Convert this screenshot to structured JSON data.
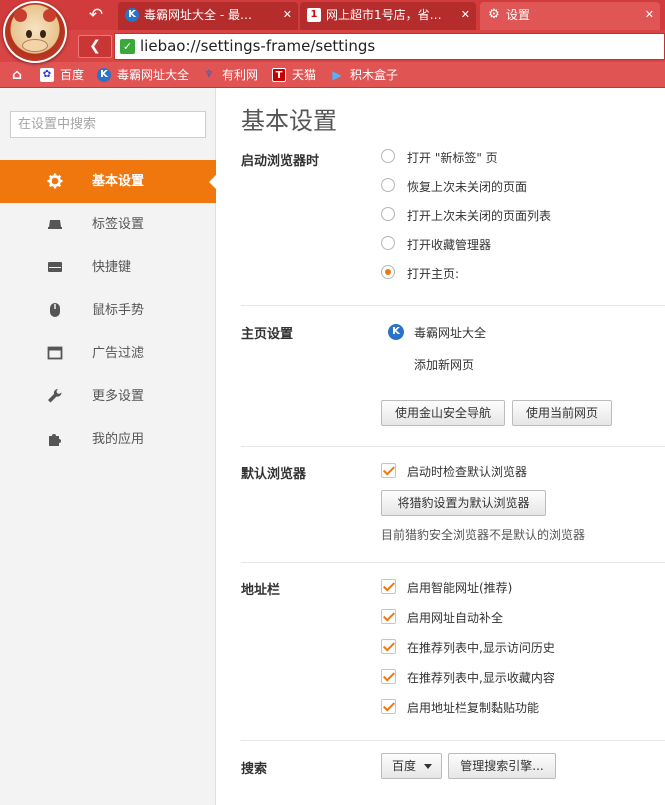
{
  "window": {
    "tabs": [
      {
        "title": "毒霸网址大全 - 最安...",
        "icon": "K",
        "active": false
      },
      {
        "title": "网上超市1号店，省力...",
        "icon": "1",
        "active": false
      },
      {
        "title": "设置",
        "icon": "gear-icon",
        "active": true
      }
    ],
    "url": "liebao://settings-frame/settings"
  },
  "bookmarks": [
    {
      "label": "",
      "icon": "home-icon"
    },
    {
      "label": "百度",
      "icon": "baidu-paw-icon"
    },
    {
      "label": "毒霸网址大全",
      "icon": "K"
    },
    {
      "label": "有利网",
      "icon": "youli-icon"
    },
    {
      "label": "天猫",
      "icon": "T"
    },
    {
      "label": "积木盒子",
      "icon": "play-icon"
    }
  ],
  "sidebar": {
    "search_placeholder": "在设置中搜索",
    "items": [
      {
        "label": "基本设置",
        "icon": "gear-icon",
        "active": true
      },
      {
        "label": "标签设置",
        "icon": "tab-icon",
        "active": false
      },
      {
        "label": "快捷键",
        "icon": "keyboard-icon",
        "active": false
      },
      {
        "label": "鼠标手势",
        "icon": "mouse-icon",
        "active": false
      },
      {
        "label": "广告过滤",
        "icon": "window-icon",
        "active": false
      },
      {
        "label": "更多设置",
        "icon": "wrench-icon",
        "active": false
      },
      {
        "label": "我的应用",
        "icon": "puzzle-icon",
        "active": false
      }
    ]
  },
  "main": {
    "title": "基本设置",
    "startup": {
      "label": "启动浏览器时",
      "options": [
        {
          "label": "打开 \"新标签\" 页",
          "selected": false
        },
        {
          "label": "恢复上次未关闭的页面",
          "selected": false
        },
        {
          "label": "打开上次未关闭的页面列表",
          "selected": false
        },
        {
          "label": "打开收藏管理器",
          "selected": false
        },
        {
          "label": "打开主页:",
          "selected": true
        }
      ]
    },
    "homepage": {
      "label": "主页设置",
      "entry": "毒霸网址大全",
      "entry_icon": "K",
      "add_link": "添加新网页",
      "btn_safe_nav": "使用金山安全导航",
      "btn_current": "使用当前网页"
    },
    "default_browser": {
      "label": "默认浏览器",
      "check_label": "启动时检查默认浏览器",
      "checked": true,
      "btn_set_default": "将猎豹设置为默认浏览器",
      "status": "目前猎豹安全浏览器不是默认的浏览器"
    },
    "address_bar": {
      "label": "地址栏",
      "options": [
        {
          "label": "启用智能网址(推荐)",
          "checked": true
        },
        {
          "label": "启用网址自动补全",
          "checked": true
        },
        {
          "label": "在推荐列表中,显示访问历史",
          "checked": true
        },
        {
          "label": "在推荐列表中,显示收藏内容",
          "checked": true
        },
        {
          "label": "启用地址栏复制黏贴功能",
          "checked": true
        }
      ]
    },
    "search": {
      "label": "搜索",
      "engine": "百度",
      "btn_manage": "管理搜索引擎..."
    }
  },
  "colors": {
    "chrome_red": "#d23b3b",
    "accent_orange": "#f0770e",
    "sidebar_bg": "#f3f3f3"
  }
}
